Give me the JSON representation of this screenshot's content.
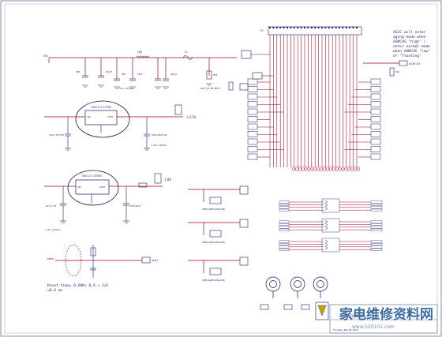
{
  "schematic": {
    "regulators": [
      {
        "part": "SW1117-33TBU",
        "output": "+3.3V"
      },
      {
        "part": "SW1117-18TBU",
        "output": "1.8V"
      }
    ],
    "connector_ref": "P1",
    "signal_out": "AGMCOS",
    "series_resistor": "RAC",
    "left_rail_label": "VIN",
    "notes": {
      "aging": [
        "AGIC will enter",
        "aging mode when",
        "AGMCOS \"high\" /",
        "enter normal mode",
        "when AGMCOS \"low\"",
        "or \"floating\""
      ],
      "reset": [
        "Reset time= 0.68K× 0.6 × 1uF",
        "=0.4 ms"
      ]
    },
    "rail_labels": [
      "+3.3V",
      "1.8V",
      "VCC",
      "AVCC",
      "VDD"
    ],
    "ferrite_label": "FB2",
    "fuse_label": "F1",
    "title_block": {
      "title": "MCDH-FD3E V1",
      "footer": "Thursday, May 06, 2010"
    }
  },
  "watermark": {
    "cn": "家电维修资料网",
    "url": "www.520101.com"
  }
}
